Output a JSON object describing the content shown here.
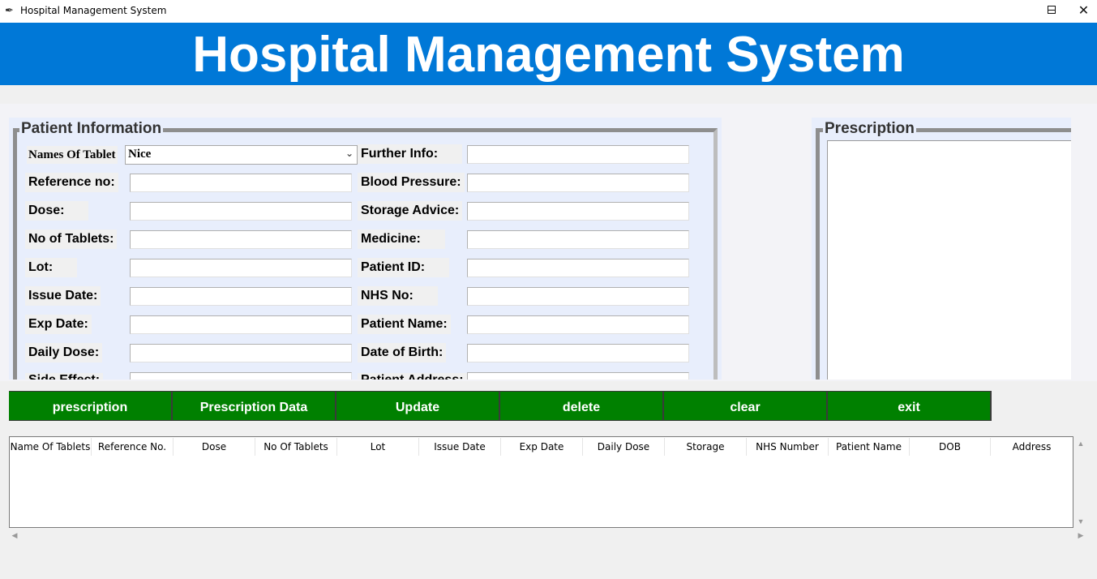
{
  "window": {
    "title": "Hospital Management System",
    "minimize_glyph": "—",
    "maximize_glyph": "☐",
    "close_glyph": "✕"
  },
  "header": {
    "title": "Hospital Management System"
  },
  "patient_info": {
    "legend": "Patient Information",
    "names_of_tablet_label": "Names Of Tablet",
    "names_of_tablet_value": "Nice",
    "left_labels": [
      "Reference no:",
      "Dose:",
      "No of Tablets:",
      "Lot:",
      "Issue Date:",
      "Exp Date:",
      "Daily Dose:",
      "Side Effect:"
    ],
    "right_labels": [
      "Further Info:",
      "Blood Pressure:",
      "Storage Advice:",
      "Medicine:",
      "Patient ID:",
      "NHS No:",
      "Patient Name:",
      "Date of Birth:",
      "Patient Address:"
    ]
  },
  "prescription": {
    "legend": "Prescription",
    "text": ""
  },
  "buttons": [
    "prescription",
    "Prescription Data",
    "Update",
    "delete",
    "clear",
    "exit"
  ],
  "table": {
    "columns": [
      "Name Of Tablets",
      "Reference No.",
      "Dose",
      "No Of Tablets",
      "Lot",
      "Issue Date",
      "Exp Date",
      "Daily Dose",
      "Storage",
      "NHS Number",
      "Patient Name",
      "DOB",
      "Address"
    ],
    "rows": []
  },
  "icons": {
    "app": "feather-icon",
    "dropdown": "chevron-down-icon",
    "scroll_up": "triangle-up-icon",
    "scroll_down": "triangle-down-icon",
    "scroll_left": "triangle-left-icon",
    "scroll_right": "triangle-right-icon"
  },
  "colors": {
    "header_bg": "#0078d7",
    "button_bg": "#008000",
    "form_bg": "#e8eefc"
  }
}
